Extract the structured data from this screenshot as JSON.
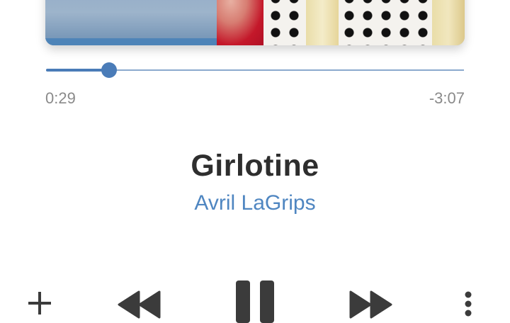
{
  "player": {
    "elapsed": "0:29",
    "remaining": "-3:07",
    "progress": 0.15,
    "track_title": "Girlotine",
    "artist": "Avril LaGrips"
  },
  "colors": {
    "accent": "#4a7cb8",
    "artist_text": "#4f86c1",
    "title_text": "#2e2e2e",
    "time_text": "#8a8a8a",
    "control_icon": "#3b3b3b"
  },
  "controls": {
    "add": "plus-icon",
    "previous": "rewind-icon",
    "play_pause": "pause-icon",
    "next": "fast-forward-icon",
    "more": "more-vertical-icon"
  }
}
